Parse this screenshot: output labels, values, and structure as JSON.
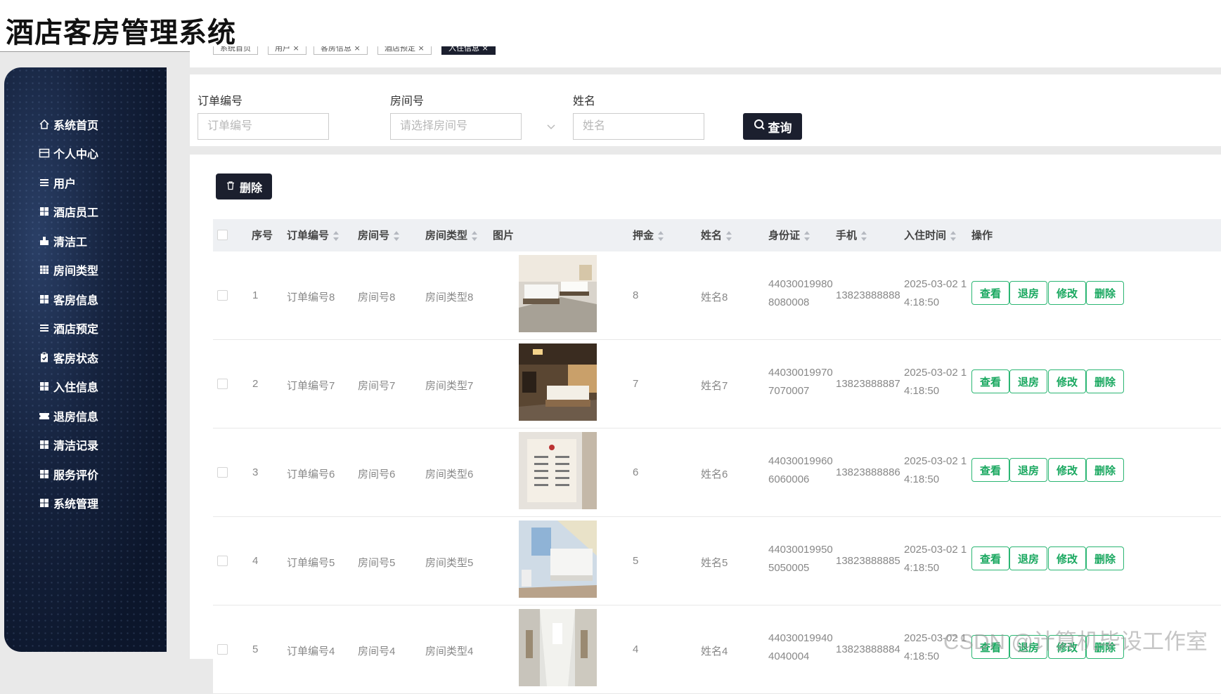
{
  "app": {
    "title": "酒店客房管理系统"
  },
  "sidebar": {
    "items": [
      {
        "label": "系统首页",
        "icon": "home-icon"
      },
      {
        "label": "个人中心",
        "icon": "profile-icon"
      },
      {
        "label": "用户",
        "icon": "list-icon"
      },
      {
        "label": "酒店员工",
        "icon": "grid-icon"
      },
      {
        "label": "清洁工",
        "icon": "cleaning-icon"
      },
      {
        "label": "房间类型",
        "icon": "grid-icon"
      },
      {
        "label": "客房信息",
        "icon": "grid-icon"
      },
      {
        "label": "酒店预定",
        "icon": "list-icon"
      },
      {
        "label": "客房状态",
        "icon": "clipboard-icon"
      },
      {
        "label": "入住信息",
        "icon": "grid-icon"
      },
      {
        "label": "退房信息",
        "icon": "ticket-icon"
      },
      {
        "label": "清洁记录",
        "icon": "grid-icon"
      },
      {
        "label": "服务评价",
        "icon": "grid-icon"
      },
      {
        "label": "系统管理",
        "icon": "grid-icon"
      }
    ]
  },
  "tabs": [
    {
      "label": "系统首页"
    },
    {
      "label": "用户 ×"
    },
    {
      "label": "客房信息 ×"
    },
    {
      "label": "酒店预定 ×"
    },
    {
      "label": "入住信息 ×"
    }
  ],
  "search": {
    "order_label": "订单编号",
    "order_placeholder": "订单编号",
    "room_label": "房间号",
    "room_placeholder": "请选择房间号",
    "name_label": "姓名",
    "name_placeholder": "姓名",
    "query_label": "查询"
  },
  "toolbar": {
    "delete_label": "删除"
  },
  "table": {
    "headers": {
      "index": "序号",
      "order": "订单编号",
      "room": "房间号",
      "type": "房间类型",
      "image": "图片",
      "deposit": "押金",
      "name": "姓名",
      "idcard": "身份证",
      "phone": "手机",
      "checkin": "入住时间",
      "actions": "操作"
    },
    "actions": {
      "view": "查看",
      "checkout": "退房",
      "edit": "修改",
      "delete": "删除"
    },
    "rows": [
      {
        "index": "1",
        "order": "订单编号8",
        "room": "房间号8",
        "type": "房间类型8",
        "deposit": "8",
        "name": "姓名8",
        "id1": "44030019980",
        "id2": "8080008",
        "phone": "13823888888",
        "t1": "2025-03-02 1",
        "t2": "4:18:50"
      },
      {
        "index": "2",
        "order": "订单编号7",
        "room": "房间号7",
        "type": "房间类型7",
        "deposit": "7",
        "name": "姓名7",
        "id1": "44030019970",
        "id2": "7070007",
        "phone": "13823888887",
        "t1": "2025-03-02 1",
        "t2": "4:18:50"
      },
      {
        "index": "3",
        "order": "订单编号6",
        "room": "房间号6",
        "type": "房间类型6",
        "deposit": "6",
        "name": "姓名6",
        "id1": "44030019960",
        "id2": "6060006",
        "phone": "13823888886",
        "t1": "2025-03-02 1",
        "t2": "4:18:50"
      },
      {
        "index": "4",
        "order": "订单编号5",
        "room": "房间号5",
        "type": "房间类型5",
        "deposit": "5",
        "name": "姓名5",
        "id1": "44030019950",
        "id2": "5050005",
        "phone": "13823888885",
        "t1": "2025-03-02 1",
        "t2": "4:18:50"
      },
      {
        "index": "5",
        "order": "订单编号4",
        "room": "房间号4",
        "type": "房间类型4",
        "deposit": "4",
        "name": "姓名4",
        "id1": "44030019940",
        "id2": "4040004",
        "phone": "13823888884",
        "t1": "2025-03-02 1",
        "t2": "4:18:50"
      }
    ]
  },
  "watermark": "CSDN @计算机毕设工作室",
  "colors": {
    "primary": "#1b1f2e",
    "action_green": "#1aa860",
    "sidebar_bg": "#15223d"
  }
}
